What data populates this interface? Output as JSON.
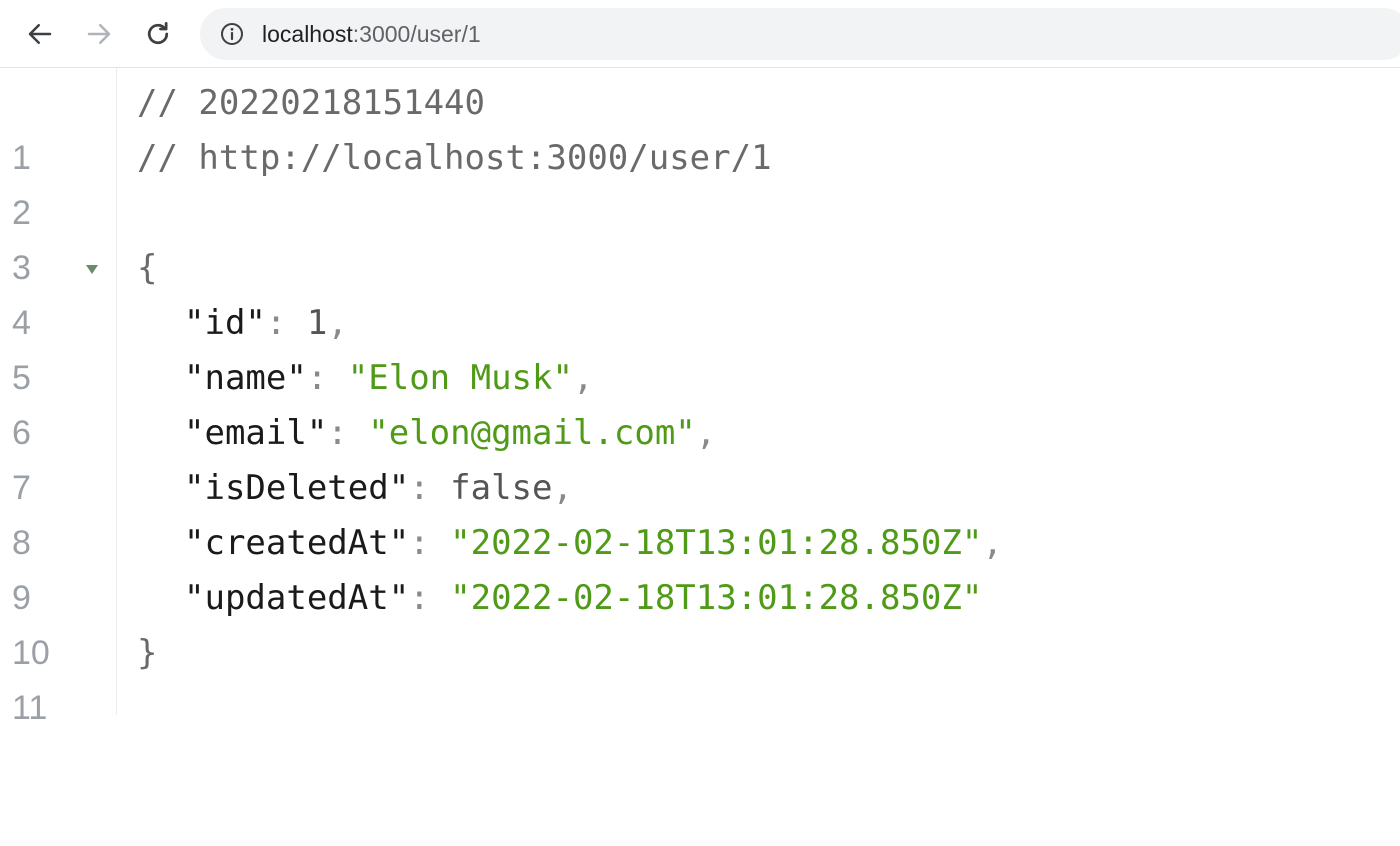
{
  "browser": {
    "url_host": "localhost",
    "url_path": ":3000/user/1"
  },
  "viewer": {
    "line_numbers": [
      "1",
      "2",
      "3",
      "4",
      "5",
      "6",
      "7",
      "8",
      "9",
      "10",
      "11"
    ],
    "comment_timestamp": "// 20220218151440",
    "comment_url": "// http://localhost:3000/user/1",
    "open_brace": "{",
    "close_brace": "}",
    "fields": [
      {
        "key": "\"id\"",
        "value": "1",
        "type": "number",
        "trail": ","
      },
      {
        "key": "\"name\"",
        "value": "\"Elon Musk\"",
        "type": "string",
        "trail": ","
      },
      {
        "key": "\"email\"",
        "value": "\"elon@gmail.com\"",
        "type": "string",
        "trail": ","
      },
      {
        "key": "\"isDeleted\"",
        "value": "false",
        "type": "boolean",
        "trail": ","
      },
      {
        "key": "\"createdAt\"",
        "value": "\"2022-02-18T13:01:28.850Z\"",
        "type": "string",
        "trail": ","
      },
      {
        "key": "\"updatedAt\"",
        "value": "\"2022-02-18T13:01:28.850Z\"",
        "type": "string",
        "trail": ""
      }
    ],
    "colon": ": "
  },
  "colors": {
    "string": "#4f9a17",
    "line_number": "#9aa0a6",
    "comment": "#6a6a6a"
  },
  "icons": {
    "back": "arrow-left-icon",
    "forward": "arrow-right-icon",
    "reload": "reload-icon",
    "info": "info-circle-icon",
    "fold": "triangle-down-icon"
  }
}
